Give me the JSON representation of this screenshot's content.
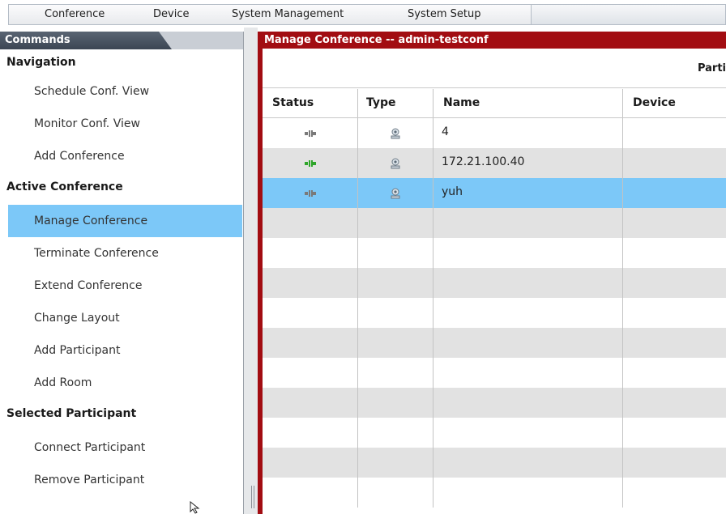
{
  "menu": {
    "items": [
      "Conference",
      "Device",
      "System Management",
      "System Setup"
    ]
  },
  "commands": {
    "title": "Commands",
    "sections": [
      {
        "label": "Navigation",
        "items": [
          "Schedule Conf. View",
          "Monitor Conf. View",
          "Add Conference"
        ]
      },
      {
        "label": "Active Conference",
        "items": [
          "Manage Conference",
          "Terminate Conference",
          "Extend Conference",
          "Change Layout",
          "Add Participant",
          "Add Room"
        ]
      },
      {
        "label": "Selected Participant",
        "items": [
          "Connect Participant",
          "Remove Participant"
        ]
      }
    ],
    "selected_item": "Manage Conference"
  },
  "panel": {
    "title": "Manage Conference -- admin-testconf",
    "subheader": "Parti"
  },
  "table": {
    "columns": [
      "Status",
      "Type",
      "Name",
      "Device"
    ],
    "rows": [
      {
        "status": "disconnected-icon",
        "type": "endpoint-icon",
        "name": "4",
        "device": ""
      },
      {
        "status": "connected-icon",
        "type": "endpoint-icon",
        "name": "172.21.100.40",
        "device": ""
      },
      {
        "status": "disconnected-icon",
        "type": "endpoint-icon",
        "name": "yuh",
        "device": "",
        "selected": true
      }
    ],
    "empty_rows": 10
  },
  "colors": {
    "selection": "#7cc8f8",
    "panel_header": "#a20d12",
    "connected": "#2fa52a",
    "disconnected": "#7a7a7a"
  }
}
